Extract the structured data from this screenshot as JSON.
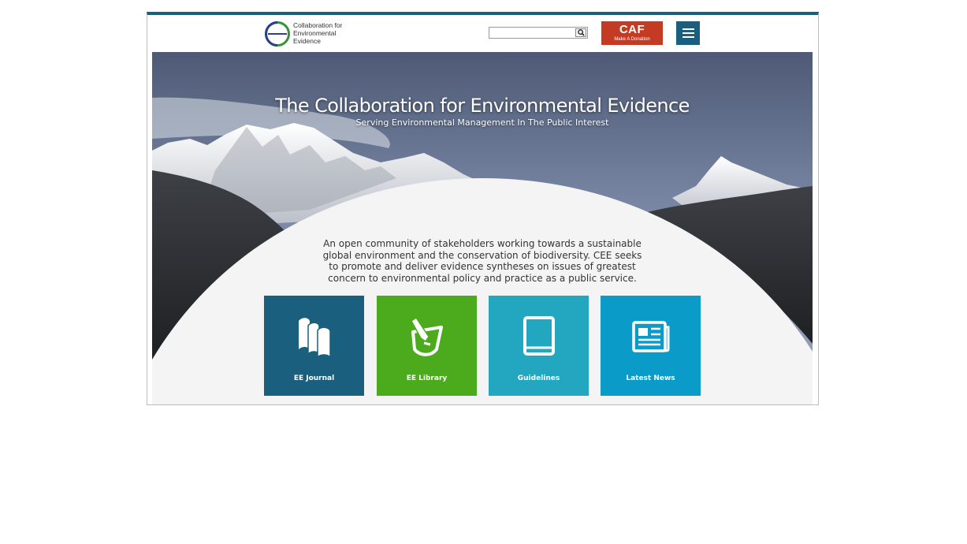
{
  "header": {
    "logo_lines": [
      "Collaboration for",
      "Environmental",
      "Evidence"
    ],
    "search_placeholder": "",
    "caf_button": {
      "title": "CAF",
      "subtitle": "Make A Donation"
    }
  },
  "hero": {
    "title": "The Collaboration for Environmental Evidence",
    "subtitle": "Serving Environmental Management In The Public Interest",
    "intro": "An open community of stakeholders working towards a sustainable global environment and the conservation of biodiversity. CEE seeks to promote and deliver evidence syntheses on issues of greatest concern to environmental policy and practice as a public service."
  },
  "tiles": [
    {
      "label": "EE Journal",
      "color": "#1b5f7e",
      "icon": "books-icon"
    },
    {
      "label": "EE Library",
      "color": "#4bab1d",
      "icon": "library-edit-icon"
    },
    {
      "label": "Guidelines",
      "color": "#23a6bf",
      "icon": "book-icon"
    },
    {
      "label": "Latest News",
      "color": "#0b9bc9",
      "icon": "newspaper-icon"
    }
  ],
  "colors": {
    "brand": "#1b5f7e",
    "donate": "#c23b22"
  }
}
